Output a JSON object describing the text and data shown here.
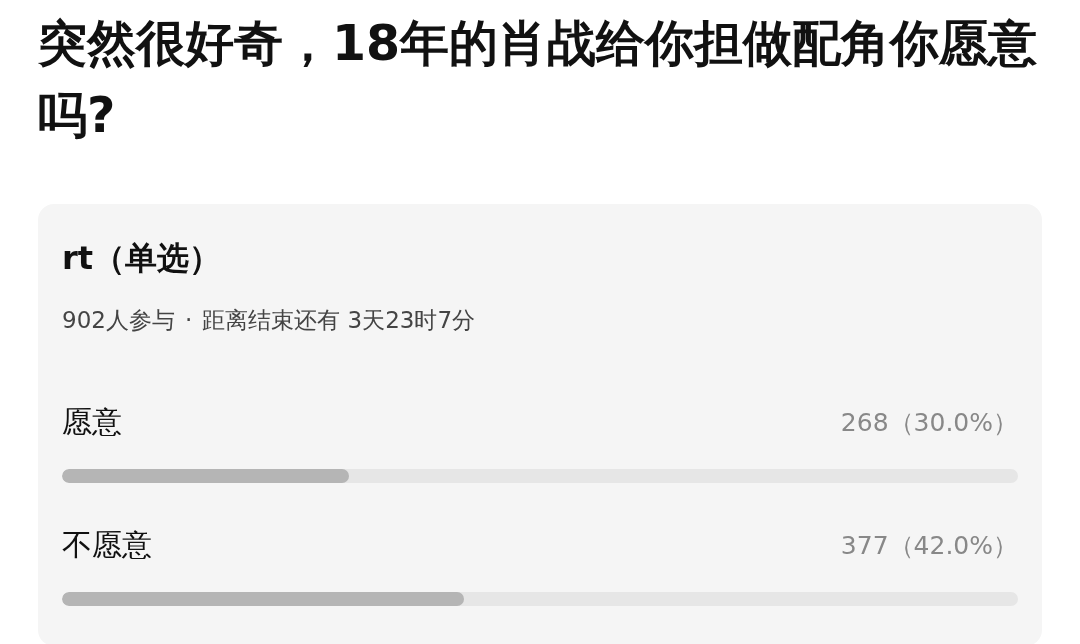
{
  "question": "突然很好奇，18年的肖战给你担做配角你愿意吗?",
  "poll": {
    "title": "rt（单选）",
    "participants": "902人参与",
    "separator": "·",
    "remaining": "距离结束还有 3天23时7分",
    "options": [
      {
        "label": "愿意",
        "result": "268（30.0%）",
        "level": 0.3
      },
      {
        "label": "不愿意",
        "result": "377（42.0%）",
        "level": 0.42
      }
    ]
  }
}
